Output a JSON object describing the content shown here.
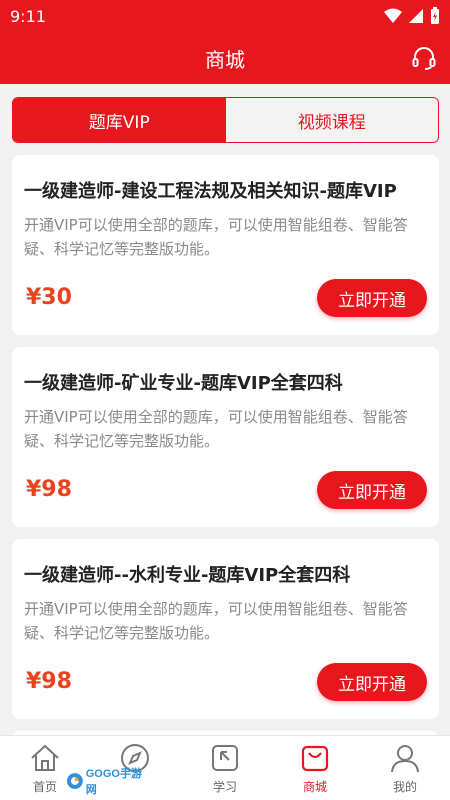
{
  "status": {
    "time": "9:11"
  },
  "header": {
    "title": "商城",
    "support_icon": "headset-icon"
  },
  "tabs": [
    {
      "label": "题库VIP",
      "active": true
    },
    {
      "label": "视频课程",
      "active": false
    }
  ],
  "products": [
    {
      "title": "一级建造师-建设工程法规及相关知识-题库VIP",
      "desc": "开通VIP可以使用全部的题库，可以使用智能组卷、智能答疑、科学记忆等完整版功能。",
      "price": "¥30",
      "button": "立即开通"
    },
    {
      "title": "一级建造师-矿业专业-题库VIP全套四科",
      "desc": "开通VIP可以使用全部的题库，可以使用智能组卷、智能答疑、科学记忆等完整版功能。",
      "price": "¥98",
      "button": "立即开通"
    },
    {
      "title": "一级建造师--水利专业-题库VIP全套四科",
      "desc": "开通VIP可以使用全部的题库，可以使用智能组卷、智能答疑、科学记忆等完整版功能。",
      "price": "¥98",
      "button": "立即开通"
    }
  ],
  "nav": [
    {
      "label": "首页",
      "icon": "home-icon",
      "active": false
    },
    {
      "label": "",
      "icon": "compass-icon",
      "active": false
    },
    {
      "label": "学习",
      "icon": "study-icon",
      "active": false
    },
    {
      "label": "商城",
      "icon": "shop-bag-icon",
      "active": true
    },
    {
      "label": "我的",
      "icon": "user-icon",
      "active": false
    }
  ],
  "watermark": "GOGO手游网",
  "colors": {
    "brand": "#e8161d",
    "price": "#e9431d"
  }
}
